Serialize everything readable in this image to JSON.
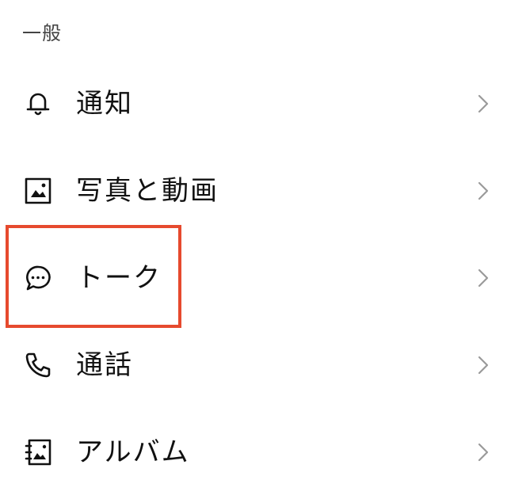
{
  "section": {
    "title": "一般"
  },
  "rows": [
    {
      "label": "通知",
      "icon": "bell-icon"
    },
    {
      "label": "写真と動画",
      "icon": "photo-icon"
    },
    {
      "label": "トーク",
      "icon": "chat-bubble-icon"
    },
    {
      "label": "通話",
      "icon": "phone-icon"
    },
    {
      "label": "アルバム",
      "icon": "album-icon"
    }
  ],
  "colors": {
    "highlight": "#e64a2e",
    "chevron": "#9a9a9a",
    "text": "#111111",
    "section_header": "#444444"
  }
}
